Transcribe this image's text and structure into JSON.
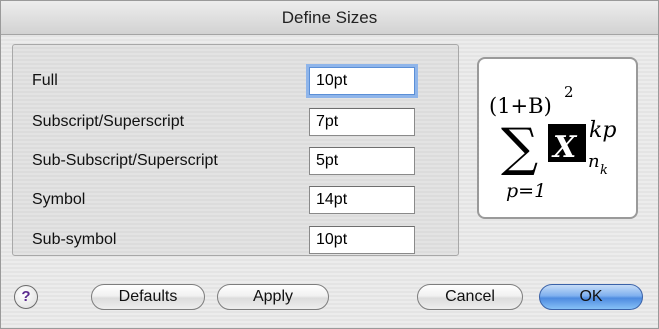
{
  "dialog": {
    "title": "Define Sizes"
  },
  "sizes": [
    {
      "label": "Full",
      "value": "10pt",
      "focused": true
    },
    {
      "label": "Subscript/Superscript",
      "value": "7pt",
      "focused": false
    },
    {
      "label": "Sub-Subscript/Superscript",
      "value": "5pt",
      "focused": false
    },
    {
      "label": "Symbol",
      "value": "14pt",
      "focused": false
    },
    {
      "label": "Sub-symbol",
      "value": "10pt",
      "focused": false
    }
  ],
  "preview": {
    "top_text": "(1+B)",
    "top_exponent": "2",
    "sum_symbol": "∑",
    "box_letter": "X",
    "superscript": "kp",
    "subscript_main": "n",
    "subscript_sub": "k",
    "lower_limit": "p=1"
  },
  "buttons": {
    "help": "?",
    "defaults": "Defaults",
    "apply": "Apply",
    "cancel": "Cancel",
    "ok": "OK"
  }
}
